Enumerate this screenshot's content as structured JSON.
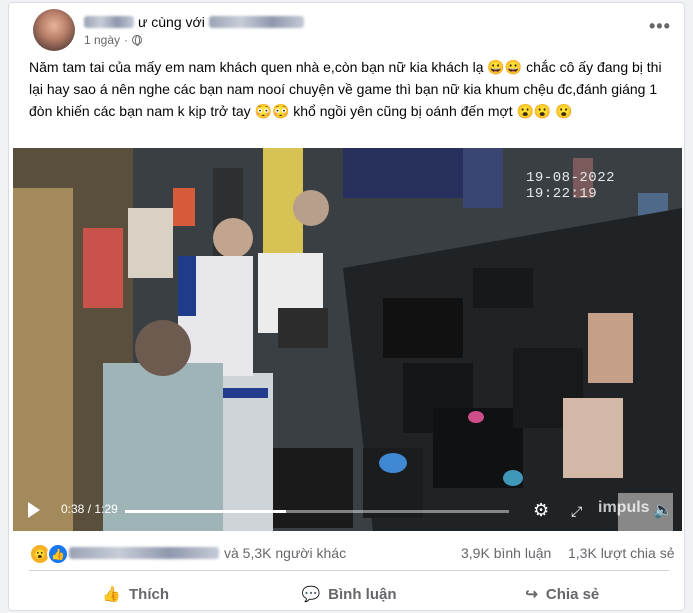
{
  "post": {
    "author_suffix": "ư cùng với",
    "time": "1 ngày",
    "dot": "·",
    "more": "•••",
    "text": "Năm tam tai của mấy em nam khách quen nhà e,còn  bạn nữ kia khách lạ 😀😀  chắc cô ấy đang bị thi lại hay sao á nên nghe các bạn nam nooí chuyện về game thì bạn nữ kia khum chệu đc,đánh giáng 1 đòn khiến các bạn nam k kịp trở tay 😳😳  khổ ngồi  yên cũng bị oánh đến mợt 😮😮 😮"
  },
  "video": {
    "timestamp": "19-08-2022 19:22:19",
    "current_time": "0:38",
    "separator": "/",
    "duration": "1:29",
    "progress": 0.42,
    "watermark": "impuls"
  },
  "stats": {
    "reactions_suffix": "và 5,3K người khác",
    "comments": "3,9K bình luận",
    "shares": "1,3K lượt chia sẻ"
  },
  "actions": {
    "like": "Thích",
    "comment": "Bình luận",
    "share": "Chia sẻ"
  },
  "icons": {
    "globe": "globe-icon",
    "more": "more-options-icon",
    "play": "play-icon",
    "settings": "settings-icon",
    "fullscreen": "fullscreen-icon",
    "volume": "volume-icon"
  },
  "colors": {
    "like_blue": "#1877f2",
    "haha_yellow": "#f7b125"
  }
}
